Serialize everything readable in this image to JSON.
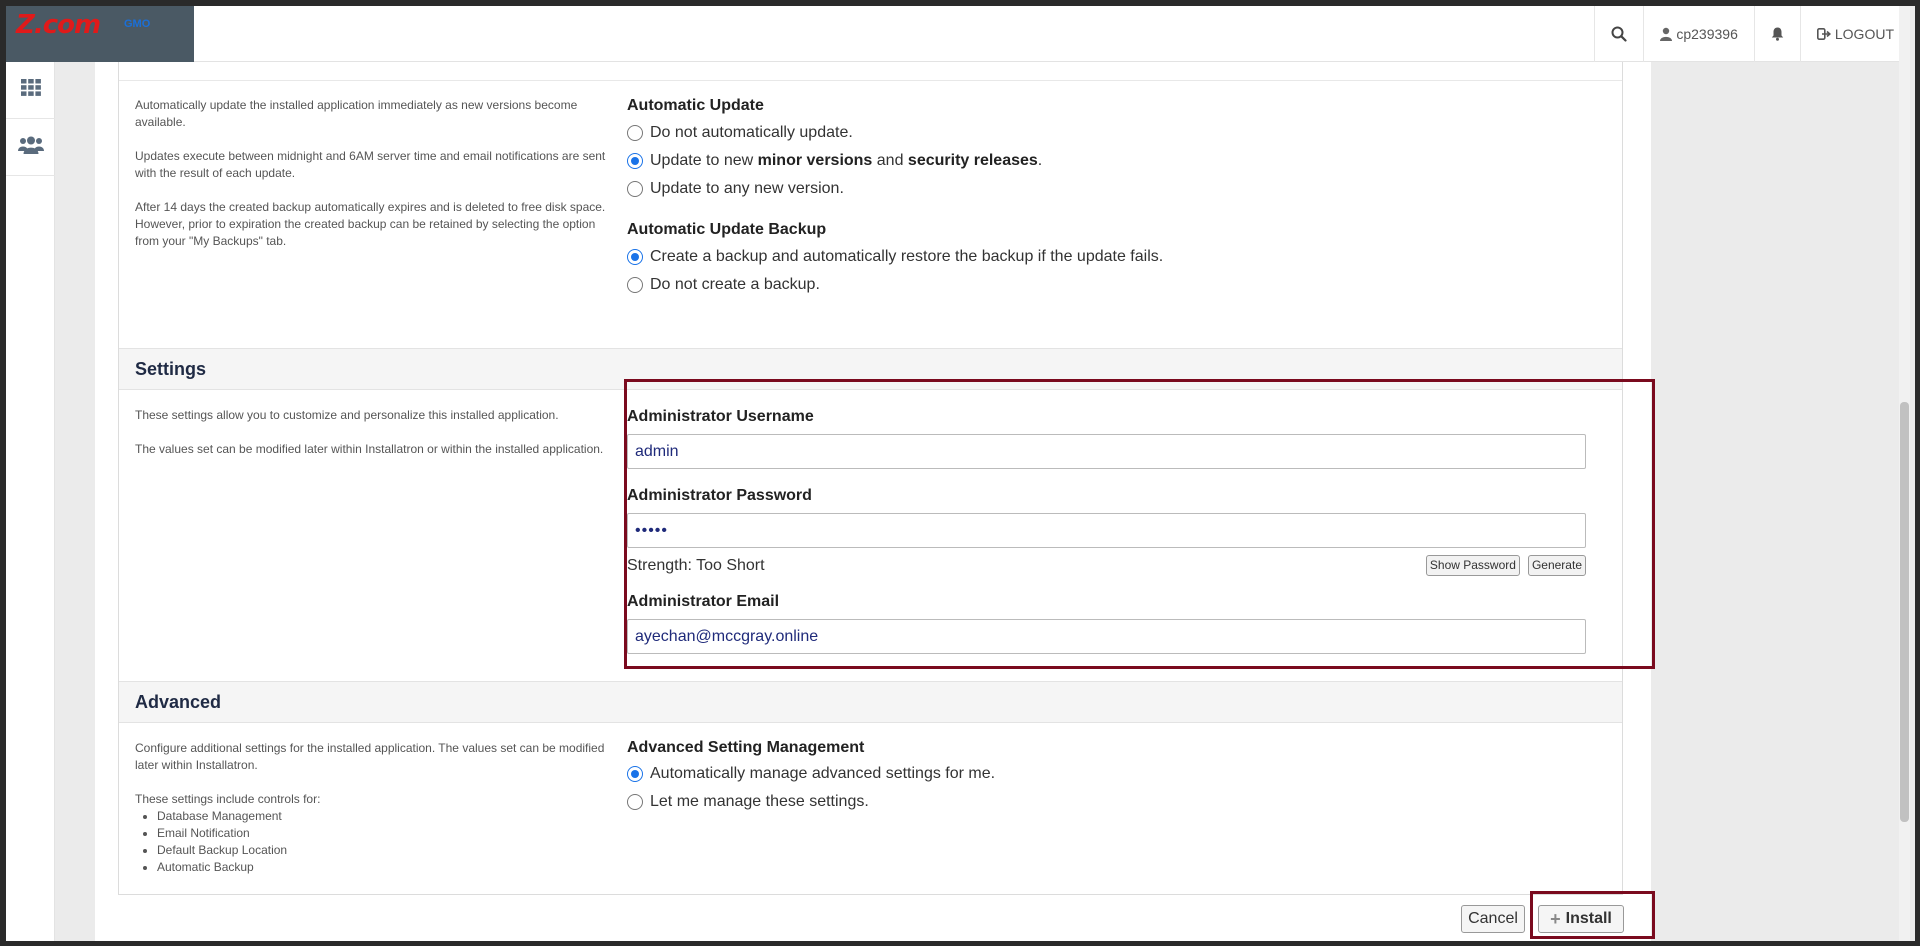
{
  "header": {
    "logo_text": "Z.com",
    "logo_sub": "GMO",
    "username": "cp239396",
    "logout_label": "LOGOUT"
  },
  "update": {
    "description": [
      "Automatically update the installed application immediately as new versions become available.",
      "Updates execute between midnight and 6AM server time and email notifications are sent with the result of each update.",
      "After 14 days the created backup automatically expires and is deleted to free disk space. However, prior to expiration the created backup can be retained by selecting the option from your \"My Backups\" tab."
    ],
    "auto_update_label": "Automatic Update",
    "opt_none": "Do not automatically update.",
    "opt_minor_pre": "Update to new ",
    "opt_minor_b1": "minor versions",
    "opt_minor_mid": " and ",
    "opt_minor_b2": "security releases",
    "opt_minor_post": ".",
    "opt_any": "Update to any new version.",
    "backup_label": "Automatic Update Backup",
    "backup_opt_create": "Create a backup and automatically restore the backup if the update fails.",
    "backup_opt_none": "Do not create a backup."
  },
  "settings": {
    "title": "Settings",
    "description": [
      "These settings allow you to customize and personalize this installed application.",
      "The values set can be modified later within Installatron or within the installed application."
    ],
    "username_label": "Administrator Username",
    "username_value": "admin",
    "password_label": "Administrator Password",
    "password_value": "•••••",
    "strength_text": "Strength: Too Short",
    "show_password_label": "Show Password",
    "generate_label": "Generate",
    "email_label": "Administrator Email",
    "email_value": "ayechan@mccgray.online"
  },
  "advanced": {
    "title": "Advanced",
    "description": "Configure additional settings for the installed application. The values set can be modified later within Installatron.",
    "controls_intro": "These settings include controls for:",
    "controls": [
      "Database Management",
      "Email Notification",
      "Default Backup Location",
      "Automatic Backup"
    ],
    "mgmt_label": "Advanced Setting Management",
    "opt_auto": "Automatically manage advanced settings for me.",
    "opt_manual": "Let me manage these settings."
  },
  "actions": {
    "cancel_label": "Cancel",
    "install_label": "Install"
  },
  "colors": {
    "highlight": "#7a0a1e",
    "radio_accent": "#1a73e8",
    "section_title": "#1f2a44"
  }
}
